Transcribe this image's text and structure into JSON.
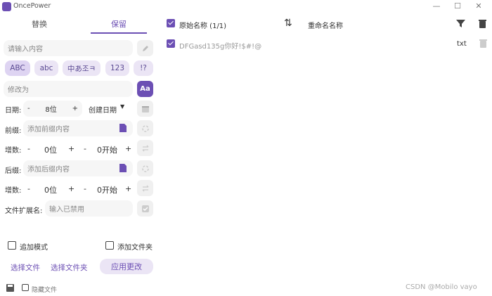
{
  "window": {
    "title": "OncePower",
    "controls": {
      "minimize": "—",
      "maximize": "☐",
      "close": "✕"
    }
  },
  "tabs": {
    "replace": "替换",
    "keep": "保留"
  },
  "keep_panel": {
    "content_placeholder": "请输入内容",
    "chips": [
      "ABC",
      "abc",
      "中あ조ㅋ",
      "123",
      "!?"
    ],
    "rename_placeholder": "修改为",
    "case_button": "Aa",
    "date": {
      "label": "日期:",
      "minus": "-",
      "value": "8位",
      "plus": "+",
      "type": "创建日期"
    },
    "prefix": {
      "label": "前缀:",
      "placeholder": "添加前缀内容"
    },
    "increment1": {
      "label": "增数:",
      "minus": "-",
      "digits": "0位",
      "plus": "+",
      "minus2": "-",
      "start": "0开始",
      "plus2": "+"
    },
    "suffix": {
      "label": "后缀:",
      "placeholder": "添加后缀内容"
    },
    "increment2": {
      "label": "增数:",
      "minus": "-",
      "digits": "0位",
      "plus": "+",
      "minus2": "-",
      "start": "0开始",
      "plus2": "+"
    },
    "ext": {
      "label": "文件扩展名:",
      "placeholder": "输入已禁用"
    },
    "append_mode": "追加模式",
    "add_folder": "添加文件夹",
    "select_files": "选择文件",
    "select_folder": "选择文件夹",
    "apply": "应用更改"
  },
  "file_list": {
    "header": {
      "original": "原始名称 (1/1)",
      "renamed": "重命名名称"
    },
    "rows": [
      {
        "original": "DFGasd135g你好!$#!@",
        "ext": "txt"
      }
    ]
  },
  "statusbar": {
    "hide_files": "隐藏文件",
    "watermark": "CSDN @Mobilo vayo"
  },
  "colors": {
    "accent": "#6c4fb4",
    "chip_bg": "#ebe5f5"
  }
}
